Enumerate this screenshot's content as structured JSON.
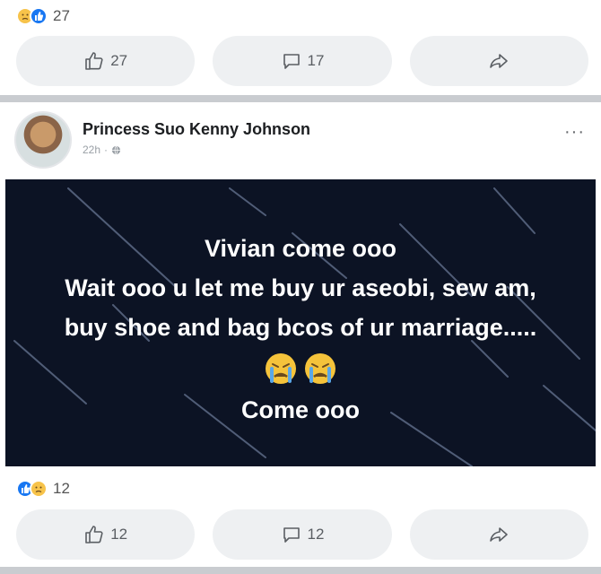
{
  "post1": {
    "reaction_count": "27",
    "like_count": "27",
    "comment_count": "17",
    "reactions": [
      "sad-emoji-icon",
      "like-icon"
    ]
  },
  "post2": {
    "author": "Princess Suo Kenny Johnson",
    "time": "22h",
    "privacy_icon": "globe-icon",
    "more_label": "···",
    "image_text": {
      "line1": "Vivian come ooo",
      "line2": "Wait ooo u let me buy ur aseobi, sew am,",
      "line3": "buy shoe and bag bcos of ur marriage.....",
      "emojis": [
        "crying-face-emoji",
        "crying-face-emoji"
      ],
      "line4": "Come ooo"
    },
    "reaction_count": "12",
    "like_count": "12",
    "comment_count": "12",
    "reactions": [
      "like-icon",
      "sad-emoji-icon"
    ]
  },
  "colors": {
    "like_blue": "#1877f2",
    "image_bg": "#0c1324",
    "button_bg": "#eef0f2",
    "divider": "#c9ccd0"
  }
}
